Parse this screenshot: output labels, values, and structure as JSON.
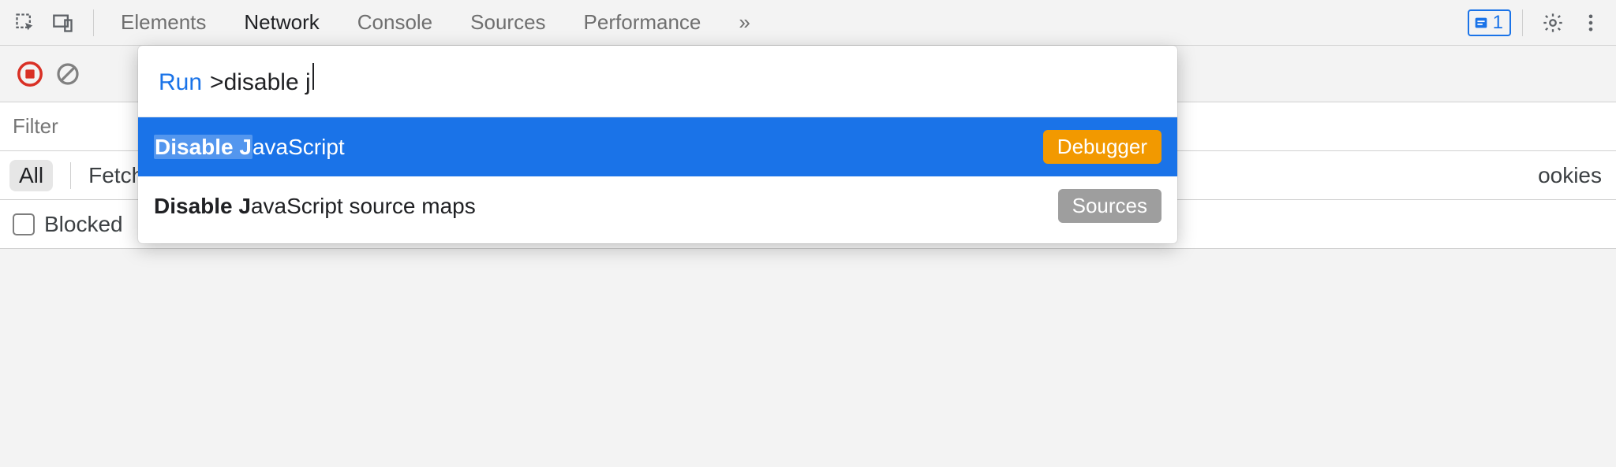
{
  "topbar": {
    "tabs": [
      "Elements",
      "Network",
      "Console",
      "Sources",
      "Performance"
    ],
    "active_tab": "Network",
    "overflow_glyph": "»",
    "issues_count": "1"
  },
  "filter": {
    "placeholder": "Filter"
  },
  "chips": {
    "all": "All",
    "fetch_partial": "Fetch",
    "cookies_partial": "ookies"
  },
  "blocked": {
    "label_partial": "Blocked"
  },
  "palette": {
    "run_label": "Run",
    "prefix": ">",
    "typed": "disable j",
    "items": [
      {
        "match": "Disable J",
        "rest": "avaScript",
        "badge": "Debugger",
        "selected": true,
        "badge_kind": "debugger"
      },
      {
        "match": "Disable J",
        "rest": "avaScript source maps",
        "badge": "Sources",
        "selected": false,
        "badge_kind": "sources"
      }
    ]
  }
}
